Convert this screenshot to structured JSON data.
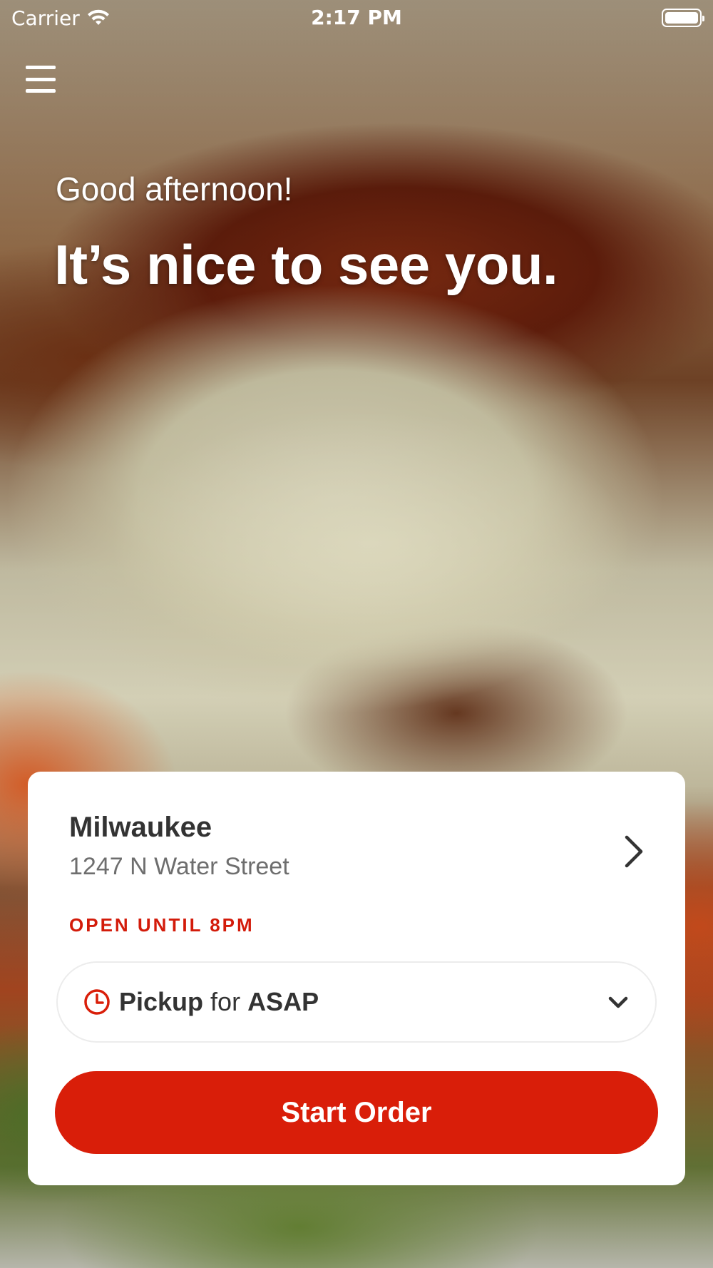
{
  "status_bar": {
    "carrier": "Carrier",
    "time": "2:17 PM",
    "icons": [
      "wifi-icon",
      "battery-icon"
    ]
  },
  "header": {
    "menu_icon": "hamburger-menu-icon",
    "greeting": "Good afternoon!",
    "headline": "It’s nice to see you."
  },
  "location": {
    "name": "Milwaukee",
    "address": "1247 N Water Street",
    "hours": "OPEN UNTIL 8PM"
  },
  "order_mode": {
    "mode": "Pickup",
    "connector": "for",
    "time": "ASAP"
  },
  "actions": {
    "start_order_label": "Start Order"
  },
  "colors": {
    "accent": "#d91e09",
    "hours_text": "#d31b0a",
    "card_background": "#ffffff",
    "primary_text": "#333333",
    "secondary_text": "#6e6e6e"
  }
}
